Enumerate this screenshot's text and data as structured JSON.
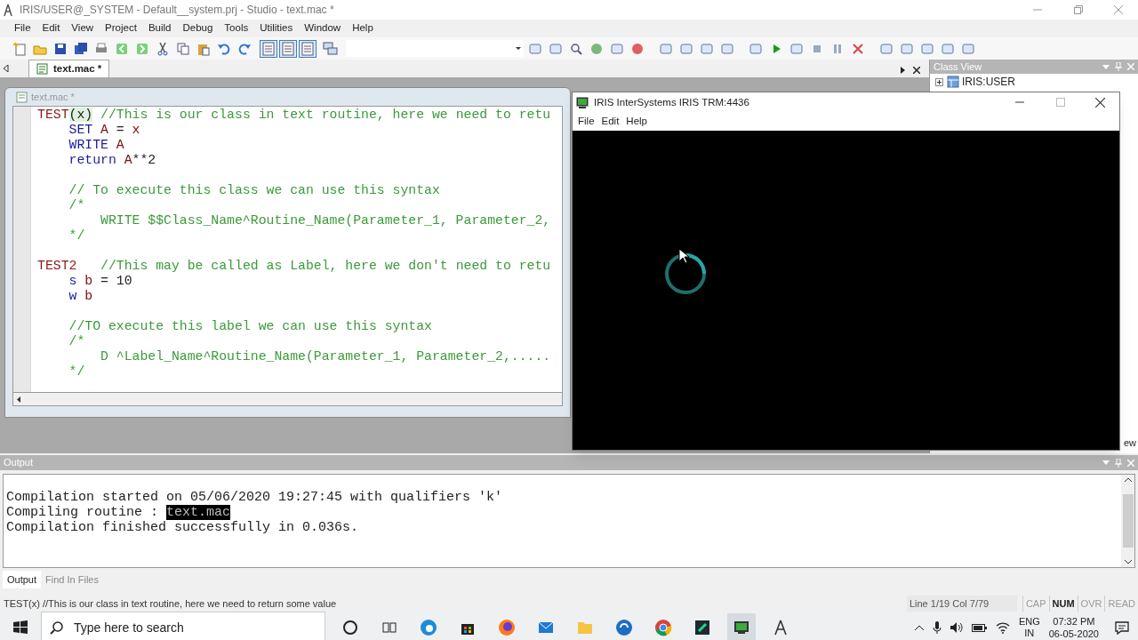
{
  "window": {
    "title": "IRIS/USER@_SYSTEM - Default__system.prj - Studio - text.mac *"
  },
  "menu": [
    "File",
    "Edit",
    "View",
    "Project",
    "Build",
    "Debug",
    "Tools",
    "Utilities",
    "Window",
    "Help"
  ],
  "document_tabs": [
    {
      "label": "text.mac *",
      "selected": true
    }
  ],
  "editor": {
    "title": "text.mac *",
    "blocks": [
      [
        [
          {
            "text": "TEST",
            "kind": "label"
          },
          {
            "text": "(x)",
            "kind": "paren"
          },
          {
            "text": " //This is our class in text routine, here we need to retu",
            "kind": "comment"
          }
        ],
        [
          {
            "text": "    SET",
            "kind": "command"
          },
          {
            "text": " A",
            "kind": "var"
          },
          {
            "text": " ="
          },
          {
            "text": " x",
            "kind": "var"
          }
        ],
        [
          {
            "text": "    WRITE",
            "kind": "command"
          },
          {
            "text": " A",
            "kind": "var"
          }
        ],
        [
          {
            "text": "    return",
            "kind": "command"
          },
          {
            "text": " A",
            "kind": "var"
          },
          {
            "text": "**2"
          }
        ]
      ],
      [
        [
          {
            "text": "    // To execute this class we can use this syntax",
            "kind": "comment"
          }
        ],
        [
          {
            "text": "    /*",
            "kind": "comment"
          }
        ],
        [
          {
            "text": "        WRITE $$Class_Name^Routine_Name(Parameter_1, Parameter_2,",
            "kind": "comment"
          }
        ],
        [
          {
            "text": "    */",
            "kind": "comment"
          }
        ]
      ],
      [
        [
          {
            "text": "TEST2",
            "kind": "label"
          },
          {
            "text": "   //This may be called as Label, here we don't need to retu",
            "kind": "comment"
          }
        ],
        [
          {
            "text": "    s",
            "kind": "command"
          },
          {
            "text": " b",
            "kind": "var"
          },
          {
            "text": " = 10"
          }
        ],
        [
          {
            "text": "    w",
            "kind": "command"
          },
          {
            "text": " b",
            "kind": "var"
          }
        ]
      ],
      [
        [
          {
            "text": "    //TO execute this label we can use this syntax",
            "kind": "comment"
          }
        ],
        [
          {
            "text": "    /*",
            "kind": "comment"
          }
        ],
        [
          {
            "text": "        D ^Label_Name^Routine_Name(Parameter_1, Parameter_2,.....",
            "kind": "comment"
          }
        ],
        [
          {
            "text": "    */",
            "kind": "comment"
          }
        ]
      ]
    ]
  },
  "class_view": {
    "title": "Class View",
    "tree": [
      {
        "label": "IRIS:USER",
        "expanded": false
      }
    ],
    "cut_label": "ew"
  },
  "terminal": {
    "title": "IRIS InterSystems IRIS TRM:4436",
    "menu": [
      "File",
      "Edit",
      "Help"
    ]
  },
  "output": {
    "title": "Output",
    "lines": [
      [
        {
          "text": "Compilation started on 05/06/2020 19:27:45 with qualifiers 'k'",
          "selected": false
        }
      ],
      [
        {
          "text": "Compiling routine : ",
          "selected": false
        },
        {
          "text": "text.mac",
          "selected": true
        }
      ],
      [
        {
          "text": "Compilation finished successfully in 0.036s.",
          "selected": false
        }
      ]
    ],
    "tabs": [
      {
        "label": "Output",
        "selected": true
      },
      {
        "label": "Find In Files",
        "selected": false
      }
    ]
  },
  "status_bar": {
    "message": "TEST(x) //This is our class in text routine, here we need to return some value",
    "position": "Line 1/19 Col 7/79",
    "indicators": [
      {
        "label": "CAP",
        "on": false
      },
      {
        "label": "NUM",
        "on": true
      },
      {
        "label": "OVR",
        "on": false
      },
      {
        "label": "READ",
        "on": false
      }
    ]
  },
  "taskbar": {
    "search_placeholder": "Type here to search",
    "language": "ENG",
    "region": "IN",
    "time": "07:32 PM",
    "date": "06-05-2020"
  }
}
